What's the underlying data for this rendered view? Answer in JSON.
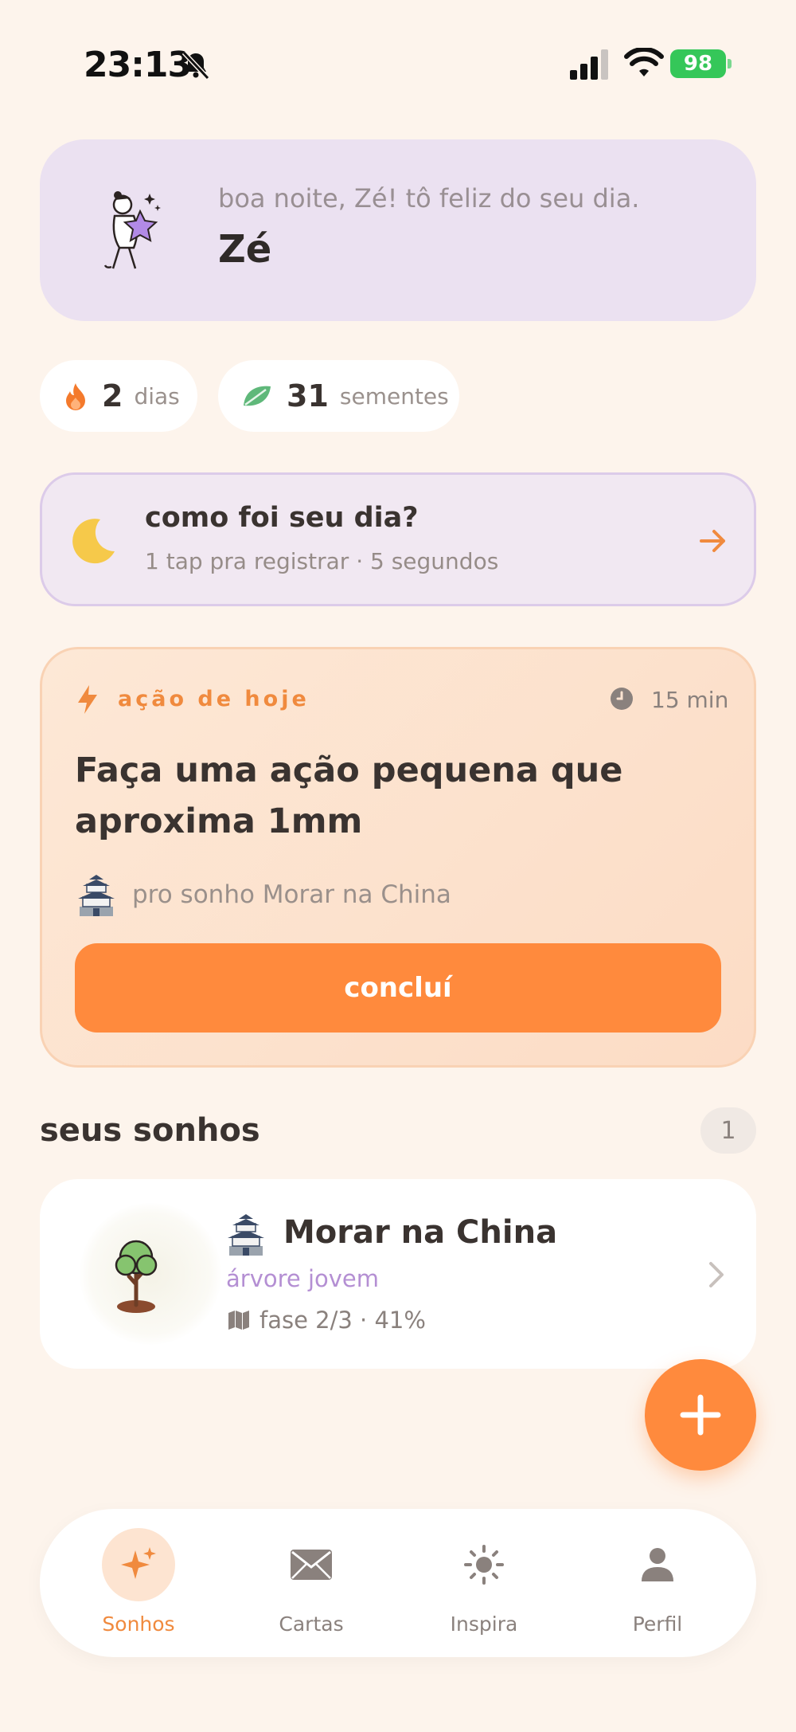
{
  "status_bar": {
    "time": "23:13",
    "battery": "98"
  },
  "greeting": {
    "line": "boa noite, Zé! tô feliz do seu dia.",
    "name": "Zé"
  },
  "stats": {
    "streak_value": "2",
    "streak_unit": "dias",
    "seeds_value": "31",
    "seeds_unit": "sementes"
  },
  "reflection": {
    "title": "como foi seu dia?",
    "subtitle": "1 tap pra registrar · 5 segundos"
  },
  "today_action": {
    "label": "ação de hoje",
    "duration": "15 min",
    "title": "Faça uma ação pequena que aproxima 1mm",
    "dream_ref": "pro sonho Morar na China",
    "button_label": "concluí"
  },
  "dreams_section": {
    "title": "seus sonhos",
    "count": "1",
    "items": [
      {
        "title": "Morar na China",
        "stage": "árvore jovem",
        "progress_text": "fase 2/3 · 41%",
        "progress_percent": 41
      }
    ]
  },
  "colors": {
    "accent": "#ff8a3d",
    "background": "#fdf4ec",
    "greeting_card": "#ebe1f1",
    "stage_purple": "#b48fd3"
  },
  "nav": {
    "items": [
      {
        "label": "Sonhos",
        "icon": "sparkles-icon",
        "active": true
      },
      {
        "label": "Cartas",
        "icon": "envelope-icon",
        "active": false
      },
      {
        "label": "Inspira",
        "icon": "sun-icon",
        "active": false
      },
      {
        "label": "Perfil",
        "icon": "person-icon",
        "active": false
      }
    ]
  }
}
